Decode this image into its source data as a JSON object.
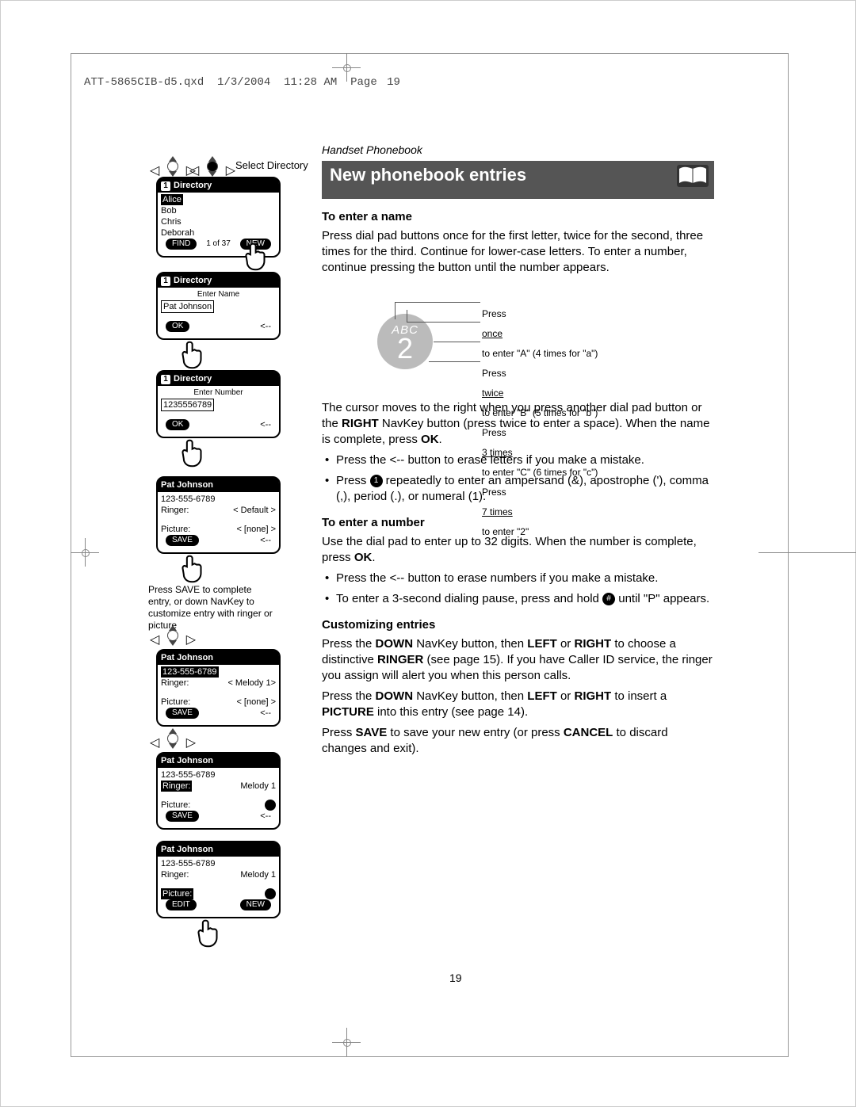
{
  "doc_header": {
    "file": "ATT-5865CIB-d5.qxd",
    "date": "1/3/2004",
    "time": "11:28 AM",
    "page_label": "Page",
    "page_num": "19"
  },
  "page_number": "19",
  "navkey_label": "Select Directory",
  "screens": {
    "s1": {
      "hdr_idx": "1",
      "hdr": "Directory",
      "names": [
        "Alice",
        "Bob",
        "Chris",
        "Deborah"
      ],
      "footer_left": "FIND",
      "footer_mid": "1 of 37",
      "footer_right": "NEW"
    },
    "s2": {
      "hdr_idx": "1",
      "hdr": "Directory",
      "prompt": "Enter Name",
      "value": "Pat Johnson",
      "footer_left": "OK",
      "footer_right": "<--"
    },
    "s3": {
      "hdr_idx": "1",
      "hdr": "Directory",
      "prompt": "Enter Number",
      "value": "1235556789",
      "footer_left": "OK",
      "footer_right": "<--"
    },
    "s4": {
      "hdr": "Pat Johnson",
      "phone": "123-555-6789",
      "ringer_lbl": "Ringer:",
      "ringer_val": "< Default >",
      "picture_lbl": "Picture:",
      "picture_val": "< [none] >",
      "footer_left": "SAVE",
      "footer_right": "<--"
    },
    "s5": {
      "hdr": "Pat Johnson",
      "phone": "123-555-6789",
      "ringer_lbl": "Ringer:",
      "ringer_val": "< Melody 1>",
      "picture_lbl": "Picture:",
      "picture_val": "< [none] >",
      "footer_left": "SAVE",
      "footer_right": "<--"
    },
    "s6": {
      "hdr": "Pat Johnson",
      "phone": "123-555-6789",
      "ringer_lbl": "Ringer:",
      "ringer_val": "Melody 1",
      "picture_lbl": "Picture:",
      "footer_left": "SAVE",
      "footer_right": "<--"
    },
    "s7": {
      "hdr": "Pat Johnson",
      "phone": "123-555-6789",
      "ringer_lbl": "Ringer:",
      "ringer_val": "Melody 1",
      "picture_lbl": "Picture:",
      "footer_left": "EDIT",
      "footer_right": "NEW"
    }
  },
  "side_caption": "Press SAVE to complete entry, or down NavKey to customize entry with ringer or picture",
  "right": {
    "sub": "Handset Phonebook",
    "bar": "New phonebook entries",
    "h1": "To enter a name",
    "p1": "Press dial pad buttons once for the first letter, twice for the second, three times for the third. Continue for lower-case letters. To enter a number, continue pressing the button until the number appears.",
    "abc": "ABC",
    "two": "2",
    "press_lines": [
      "Press once to enter \"A\" (4 times for \"a\")",
      "Press twice to enter \"B\" (5 times for \"b\")",
      "Press 3 times to enter \"C\" (6 times for \"c\")",
      "Press 7 times to enter \"2\""
    ],
    "p2_a": "The cursor moves to the right when you press another dial pad button or the ",
    "p2_b": "RIGHT",
    "p2_c": " NavKey button (press twice to enter a space). When the name is complete, press ",
    "p2_d": "OK",
    "p2_e": ".",
    "b1_a": "Press the ",
    "b1_b": "<--",
    "b1_c": " button to erase letters if you make a mistake.",
    "b2_a": "Press ",
    "b2_key": "1",
    "b2_b": " repeatedly to enter an ampersand (&), apostrophe ('), comma (,), period (.), or numeral (1).",
    "h2": "To enter a number",
    "p3_a": "Use the dial pad to enter up to 32 digits. When the number is complete, press ",
    "p3_b": "OK",
    "p3_c": ".",
    "b3_a": "Press the ",
    "b3_b": "<--",
    "b3_c": " button to erase numbers if you make a mistake.",
    "b4_a": "To enter a 3-second dialing pause, press and hold ",
    "b4_key": "#",
    "b4_b": " until \"P\" appears.",
    "h3": "Customizing entries",
    "p4_a": "Press the ",
    "p4_b": "DOWN",
    "p4_c": " NavKey button, then ",
    "p4_d": "LEFT",
    "p4_e": " or ",
    "p4_f": "RIGHT",
    "p4_g": " to choose a distinctive ",
    "p4_h": "RINGER",
    "p4_i": " (see page 15). If you have Caller ID service, the ringer you assign will alert you when this person calls.",
    "p5_a": "Press the ",
    "p5_b": "DOWN",
    "p5_c": " NavKey button, then ",
    "p5_d": "LEFT",
    "p5_e": " or ",
    "p5_f": "RIGHT",
    "p5_g": " to insert a ",
    "p5_h": "PICTURE",
    "p5_i": " into this entry (see page 14).",
    "p6_a": "Press ",
    "p6_b": "SAVE",
    "p6_c": " to save your new entry (or press ",
    "p6_d": "CANCEL",
    "p6_e": " to discard changes and exit)."
  }
}
